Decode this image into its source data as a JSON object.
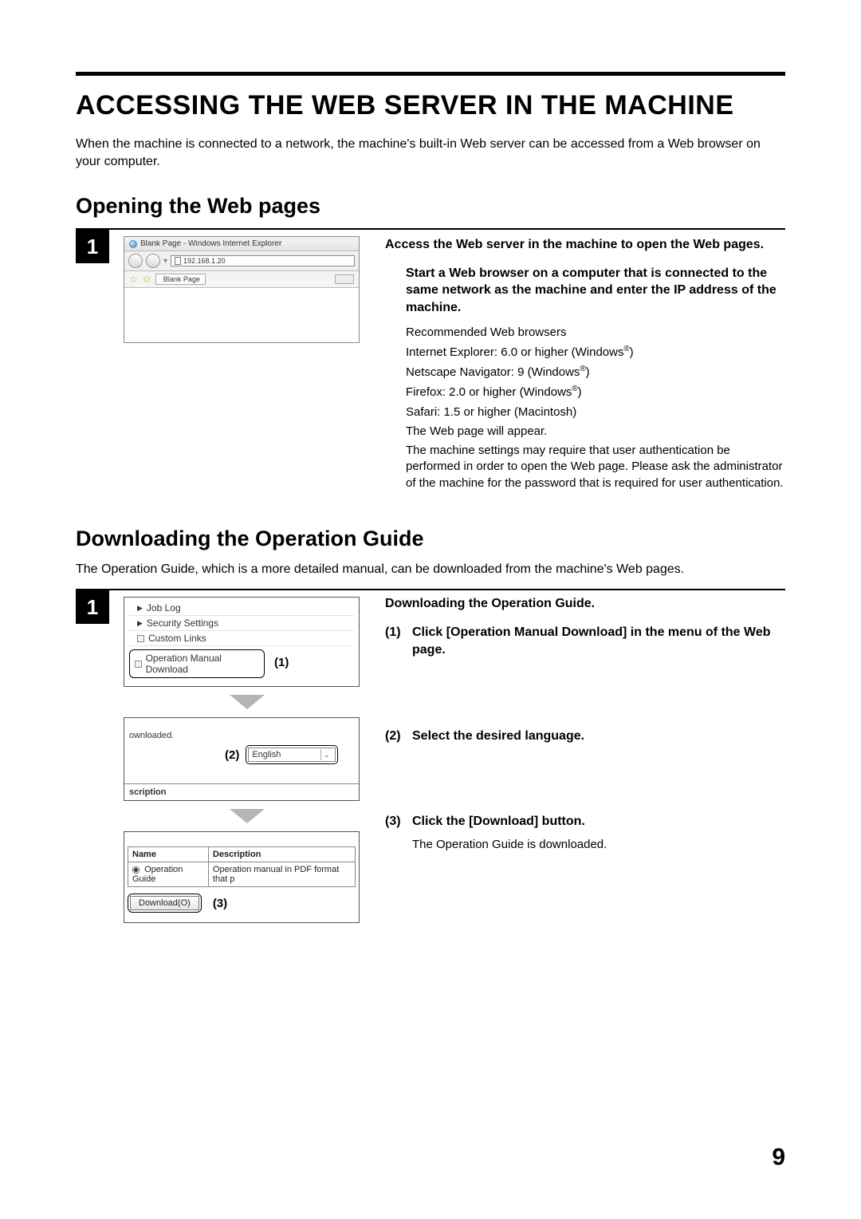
{
  "page_number": "9",
  "title": "ACCESSING THE WEB SERVER IN THE MACHINE",
  "intro": "When the machine is connected to a network, the machine's built-in Web server can be accessed from a Web browser on your computer.",
  "section1": {
    "heading": "Opening the Web pages",
    "step_number": "1",
    "browser": {
      "window_title": "Blank Page - Windows Internet Explorer",
      "address": "192.168.1.20",
      "tab_label": "Blank Page"
    },
    "lead": "Access the Web server in the machine to open the Web pages.",
    "sub_lead": "Start a Web browser on a computer that is connected to the same network as the machine and enter the IP address of the machine.",
    "rec_label": "Recommended Web browsers",
    "rec_ie": "Internet Explorer: 6.0 or higher (Windows",
    "rec_nn": "Netscape Navigator: 9 (Windows",
    "rec_ff": "Firefox: 2.0 or higher (Windows",
    "rec_sf": "Safari: 1.5 or higher (Macintosh)",
    "appear": "The Web page will appear.",
    "auth": "The machine settings may require that user authentication be performed in order to open the Web page. Please ask the administrator of the machine for the password that is required for user authentication.",
    "reg": "®",
    "close_paren": ")"
  },
  "section2": {
    "heading": "Downloading the Operation Guide",
    "intro": "The Operation Guide, which is a more detailed manual, can be downloaded from the machine's Web pages.",
    "step_number": "1",
    "menu": {
      "items": [
        "Job Log",
        "Security Settings",
        "Custom Links"
      ],
      "highlight": "Operation Manual Download",
      "callout": "(1)"
    },
    "lang": {
      "frag_top": "ownloaded.",
      "callout": "(2)",
      "selected": "English",
      "frag_head": "scription"
    },
    "dl": {
      "col_name": "Name",
      "col_desc": "Description",
      "row_name": "Operation Guide",
      "row_desc": "Operation manual in PDF format that p",
      "button": "Download(O)",
      "callout": "(3)"
    },
    "right": {
      "lead": "Downloading the Operation Guide.",
      "i1_num": "(1)",
      "i1_text": "Click [Operation Manual Download] in the menu of the Web page.",
      "i2_num": "(2)",
      "i2_text": "Select the desired language.",
      "i3_num": "(3)",
      "i3_text": "Click the [Download] button.",
      "i3_body": "The Operation Guide is downloaded."
    }
  }
}
